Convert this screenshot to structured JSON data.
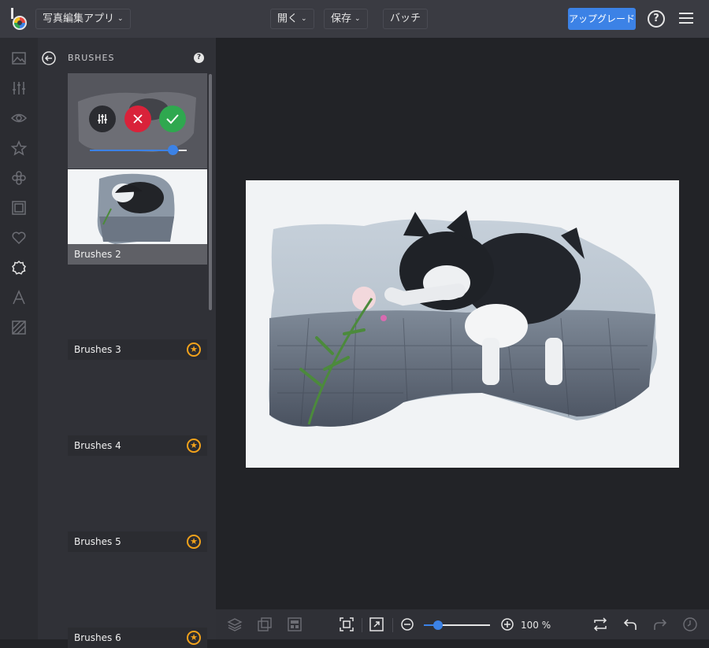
{
  "app": {
    "name_button": "写真編集アプリ",
    "menus": [
      {
        "label": "開く"
      },
      {
        "label": "保存"
      },
      {
        "label": "バッチ"
      }
    ],
    "upgrade_label": "アップグレード",
    "help_glyph": "?"
  },
  "sidebar": {
    "icons": [
      "image-icon",
      "adjust-icon",
      "eye-icon",
      "star-icon",
      "flower-icon",
      "frame-icon",
      "heart-icon",
      "badge-icon",
      "text-icon",
      "texture-icon"
    ],
    "active": "badge-icon"
  },
  "panel": {
    "title": "BRUSHES",
    "help_glyph": "?",
    "items": [
      {
        "label": "Brushes 2",
        "premium": false
      },
      {
        "label": "Brushes 3",
        "premium": true
      },
      {
        "label": "Brushes 4",
        "premium": true
      },
      {
        "label": "Brushes 5",
        "premium": true
      },
      {
        "label": "Brushes 6",
        "premium": true
      }
    ],
    "active_card": {
      "intensity_fraction": 0.88
    }
  },
  "bottombar": {
    "zoom_value": "100 %",
    "zoom_fraction": 0.2
  },
  "colors": {
    "accent": "#3c82e6",
    "premium": "#f2a21b",
    "cancel": "#d9223a",
    "confirm": "#2fa84f"
  }
}
